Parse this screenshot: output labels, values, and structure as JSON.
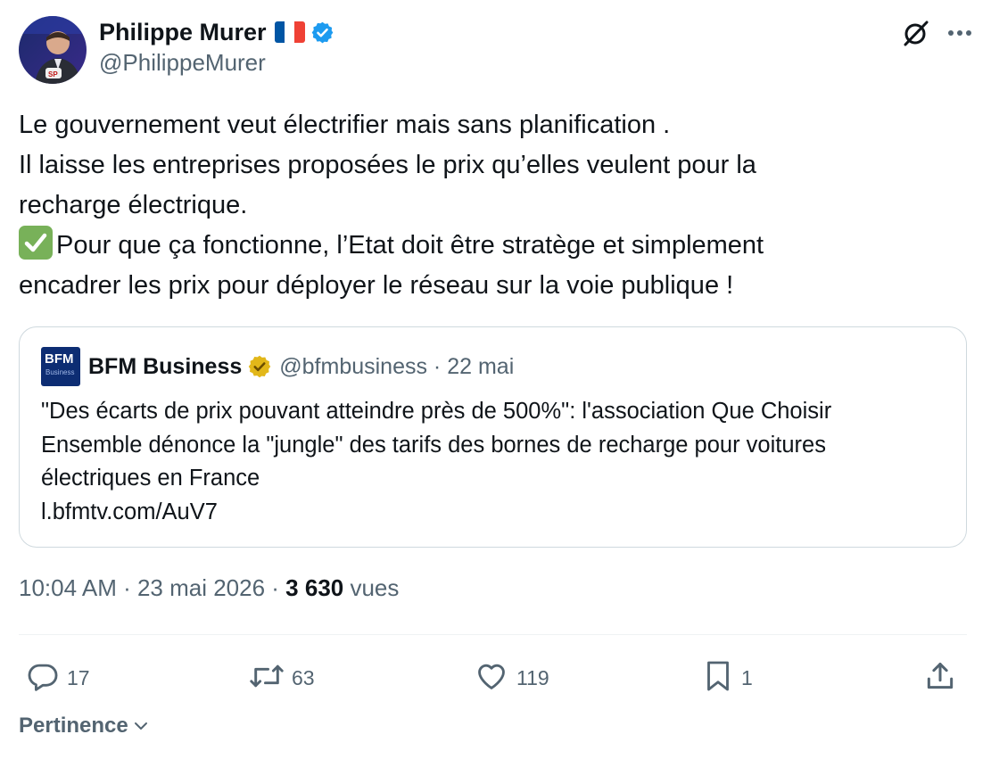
{
  "author": {
    "display_name": "Philippe Murer",
    "flag": "🇫🇷",
    "handle": "@PhilippeMurer",
    "verified_color": "#1d9bf0"
  },
  "tweet": {
    "lines": [
      "Le gouvernement veut électrifier mais sans planification .",
      "Il laisse les entreprises proposées le prix qu’elles veulent pour la",
      "recharge électrique.",
      "Pour que ça fonctionne, l’Etat doit être stratège et simplement",
      "encadrer les prix pour déployer le réseau sur la voie publique !"
    ],
    "emoji": "✅"
  },
  "quote": {
    "logo_text": "BFM",
    "logo_sub": "Business",
    "display_name": "BFM Business",
    "handle_and_date": "@bfmbusiness · 22 mai",
    "verified_color": "#e2b719",
    "lines": [
      "\"Des écarts de prix pouvant atteindre près de 500%\": l'association Que Choisir",
      "Ensemble dénonce la \"jungle\" des tarifs des bornes de recharge pour voitures",
      "électriques en France",
      "l.bfmtv.com/AuV7"
    ]
  },
  "meta": {
    "time_date": "10:04 AM · 23 mai 2026 · ",
    "views_count": "3 630",
    "views_label": " vues"
  },
  "actions": {
    "replies": "17",
    "reposts": "63",
    "likes": "119",
    "bookmarks": "1"
  },
  "sort": {
    "label": "Pertinence"
  },
  "colors": {
    "text": "#0f1419",
    "secondary": "#536471",
    "border": "#cfd9de",
    "accent": "#1d9bf0"
  }
}
